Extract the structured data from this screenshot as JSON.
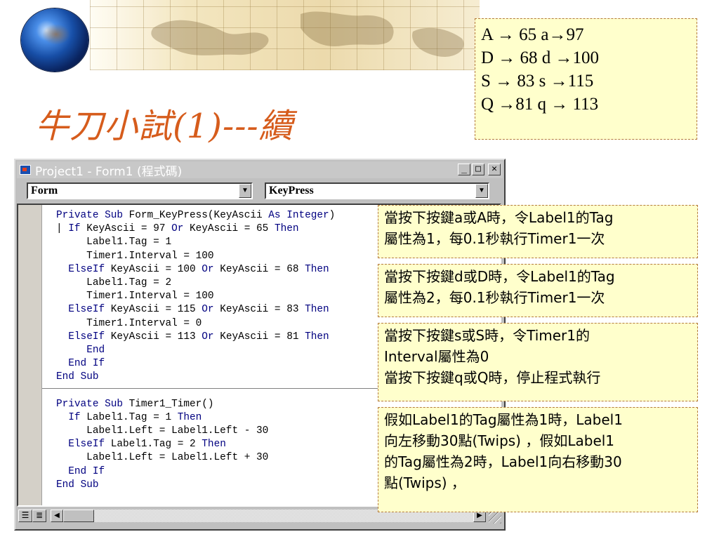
{
  "slide": {
    "title": "牛刀小試(1)---續"
  },
  "ascii_table": {
    "rows": [
      "A → 65   a→97",
      "D → 68  d →100",
      "S → 83   s →115",
      "Q →81   q → 113"
    ]
  },
  "vb_window": {
    "title": "Project1 - Form1 (程式碼)",
    "minimize_label": "_",
    "maximize_label": "□",
    "close_label": "✕",
    "object_combo": "Form",
    "procedure_combo": "KeyPress",
    "code_lines": [
      "Private Sub Form_KeyPress(KeyAscii As Integer)",
      "| If KeyAscii = 97 Or KeyAscii = 65 Then",
      "     Label1.Tag = 1",
      "     Timer1.Interval = 100",
      "  ElseIf KeyAscii = 100 Or KeyAscii = 68 Then",
      "     Label1.Tag = 2",
      "     Timer1.Interval = 100",
      "  ElseIf KeyAscii = 115 Or KeyAscii = 83 Then",
      "     Timer1.Interval = 0",
      "  ElseIf KeyAscii = 113 Or KeyAscii = 81 Then",
      "     End",
      "  End If",
      "End Sub",
      "",
      "Private Sub Timer1_Timer()",
      "  If Label1.Tag = 1 Then",
      "     Label1.Left = Label1.Left - 30",
      "  ElseIf Label1.Tag = 2 Then",
      "     Label1.Left = Label1.Left + 30",
      "  End If",
      "End Sub"
    ]
  },
  "notes": {
    "note1": [
      "當按下按鍵a或A時，令Label1的Tag",
      "屬性為1，每0.1秒執行Timer1一次"
    ],
    "note2": [
      "當按下按鍵d或D時，令Label1的Tag",
      "屬性為2，每0.1秒執行Timer1一次"
    ],
    "note3": [
      "當按下按鍵s或S時，令Timer1的",
      "Interval屬性為0",
      "當按下按鍵q或Q時，停止程式執行"
    ],
    "note4": [
      "假如Label1的Tag屬性為1時，Label1",
      "向左移動30點(Twips) ，假如Label1",
      "的Tag屬性為2時，Label1向右移動30",
      "點(Twips) ，"
    ]
  },
  "colors": {
    "title": "#d65c1c",
    "note_bg": "#ffffcc",
    "keyword": "#000080"
  }
}
